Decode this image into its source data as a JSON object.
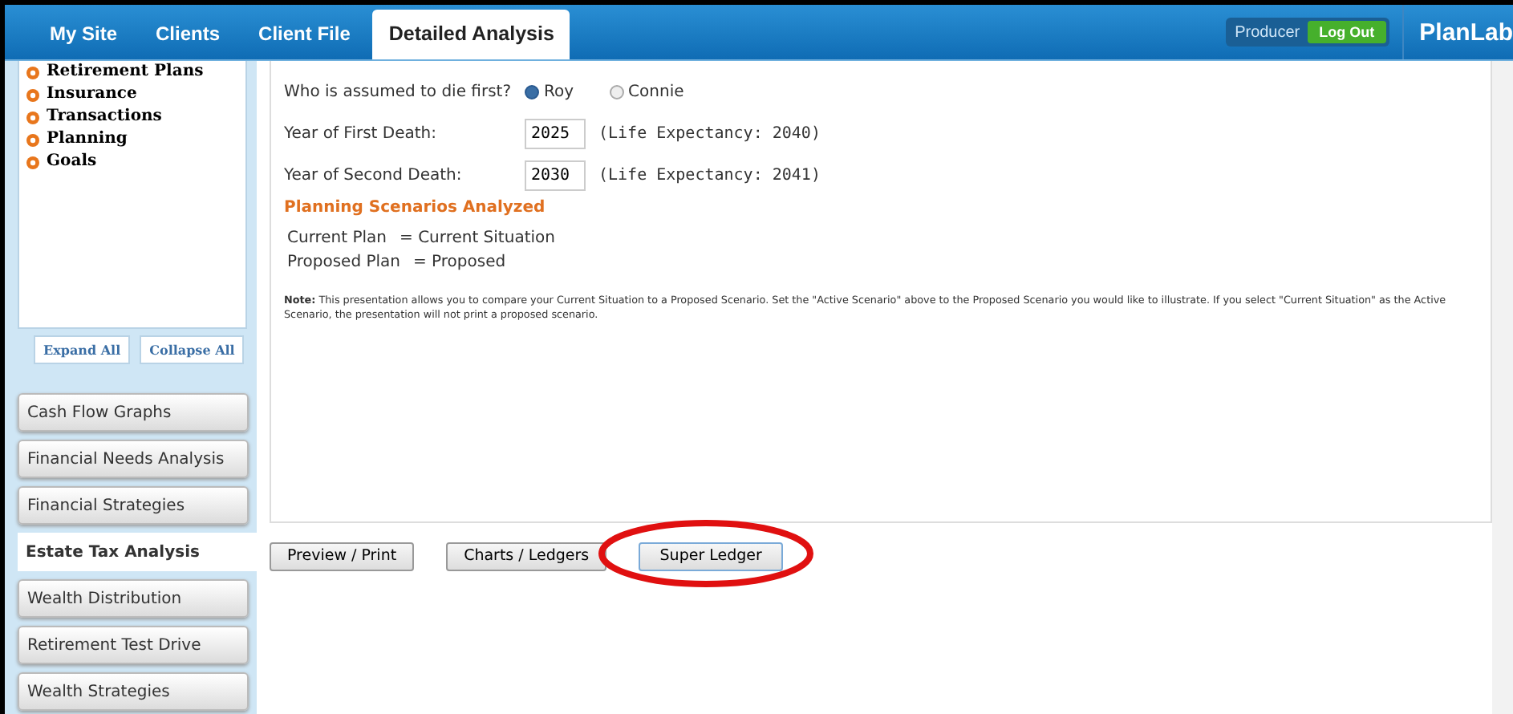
{
  "tabs": [
    {
      "label": "My Site",
      "selected": false
    },
    {
      "label": "Clients",
      "selected": false
    },
    {
      "label": "Client File",
      "selected": false
    },
    {
      "label": "Detailed Analysis",
      "selected": true
    }
  ],
  "header": {
    "role": "Producer",
    "logout": "Log Out",
    "brand": "PlanLab"
  },
  "tree": {
    "items": [
      "Retirement Plans",
      "Insurance",
      "Transactions",
      "Planning",
      "Goals"
    ],
    "expand": "Expand All",
    "collapse": "Collapse All"
  },
  "sidebar": {
    "items": [
      {
        "label": "Cash Flow Graphs",
        "selected": false
      },
      {
        "label": "Financial Needs Analysis",
        "selected": false
      },
      {
        "label": "Financial Strategies",
        "selected": false
      },
      {
        "label": "Estate Tax Analysis",
        "selected": true
      },
      {
        "label": "Wealth Distribution",
        "selected": false
      },
      {
        "label": "Retirement Test Drive",
        "selected": false
      },
      {
        "label": "Wealth Strategies",
        "selected": false
      }
    ]
  },
  "form": {
    "question": "Who is assumed to die first?",
    "options": [
      {
        "label": "Roy",
        "selected": true
      },
      {
        "label": "Connie",
        "selected": false
      }
    ],
    "fields": [
      {
        "label": "Year of First Death:",
        "value": "2025",
        "note": "(Life Expectancy: 2040)"
      },
      {
        "label": "Year of Second Death:",
        "value": "2030",
        "note": "(Life Expectancy: 2041)"
      }
    ],
    "scenarios_title": "Planning Scenarios Analyzed",
    "scenarios": [
      {
        "name": "Current Plan",
        "value": "= Current Situation"
      },
      {
        "name": "Proposed Plan",
        "value": "= Proposed"
      }
    ],
    "note": "**Note:** This presentation allows you to compare your Current Situation to a Proposed Scenario. Set the \"Active Scenario\" above to the Proposed Scenario you would like to illustrate. If you select \"Current Situation\" as the Active Scenario, the presentation will not print a proposed scenario."
  },
  "buttons": [
    {
      "label": "Preview / Print",
      "highlighted": false
    },
    {
      "label": "Charts / Ledgers",
      "highlighted": false
    },
    {
      "label": "Super Ledger",
      "highlighted": true
    }
  ]
}
